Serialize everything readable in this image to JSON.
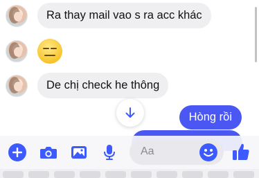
{
  "messages": {
    "m1": "Ra thay mail vao s ra acc khác",
    "m2_emoji": "expressionless-face-emoji",
    "m3": "De chị check he thông",
    "out1": "Hòng rồi"
  },
  "composer": {
    "placeholder": "Aa",
    "icons": [
      "plus-icon",
      "camera-icon",
      "image-icon",
      "microphone-icon",
      "emoji-icon",
      "thumbs-up-icon"
    ]
  },
  "colors": {
    "accent": "#3d5afe",
    "outgoing_bubble": "#4a57f2",
    "incoming_bubble": "#efeff2"
  }
}
